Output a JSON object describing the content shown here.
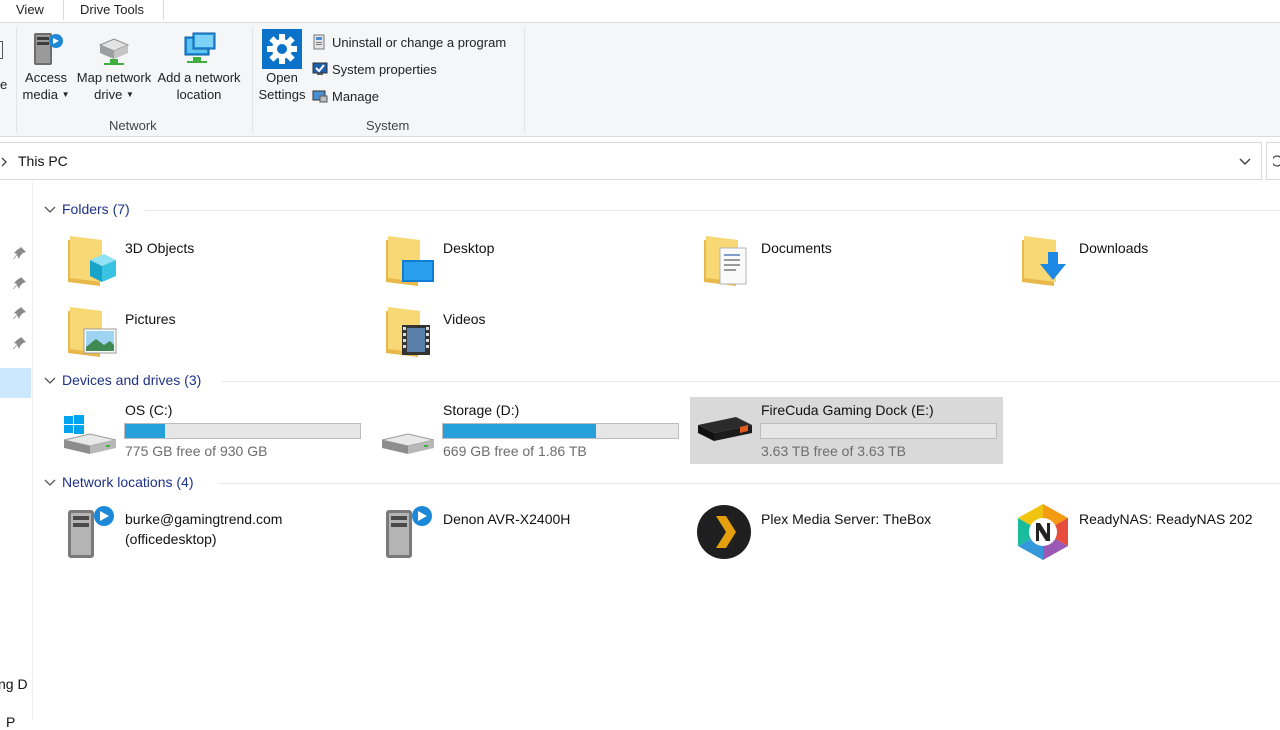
{
  "ribbon": {
    "tabs": [
      {
        "label": "View"
      },
      {
        "label": "Drive Tools"
      }
    ],
    "partial_label": "e",
    "network_group": {
      "label": "Network",
      "buttons": [
        {
          "line1": "Access",
          "line2": "media"
        },
        {
          "line1": "Map network",
          "line2": "drive"
        },
        {
          "line1": "Add a network",
          "line2": "location"
        }
      ]
    },
    "system_group": {
      "label": "System",
      "open_settings": {
        "line1": "Open",
        "line2": "Settings"
      },
      "commands": [
        {
          "label": "Uninstall or change a program"
        },
        {
          "label": "System properties"
        },
        {
          "label": "Manage"
        }
      ]
    }
  },
  "address": {
    "crumb": "This PC"
  },
  "nav": {
    "partial_label": "ng D",
    "partial_label2": "P"
  },
  "folders": {
    "heading": "Folders (7)",
    "items": [
      {
        "name": "3D Objects"
      },
      {
        "name": "Desktop"
      },
      {
        "name": "Documents"
      },
      {
        "name": "Downloads"
      },
      {
        "name": "Pictures"
      },
      {
        "name": "Videos"
      }
    ]
  },
  "drives": {
    "heading": "Devices and drives (3)",
    "items": [
      {
        "name": "OS (C:)",
        "free": "775 GB free of 930 GB",
        "used_fraction": 0.17
      },
      {
        "name": "Storage (D:)",
        "free": "669 GB free of 1.86 TB",
        "used_fraction": 0.65
      },
      {
        "name": "FireCuda Gaming Dock (E:)",
        "free": "3.63 TB free of 3.63 TB",
        "used_fraction": 0.0
      }
    ]
  },
  "network": {
    "heading": "Network locations (4)",
    "items": [
      {
        "line1": "burke@gamingtrend.com",
        "line2": "(officedesktop)"
      },
      {
        "line1": "Denon AVR-X2400H"
      },
      {
        "line1": "Plex Media Server: TheBox"
      },
      {
        "line1": "ReadyNAS: ReadyNAS 202"
      }
    ]
  },
  "colors": {
    "accent": "#26a0da",
    "group_heading": "#1e3287",
    "selection": "#d9d9d9"
  }
}
